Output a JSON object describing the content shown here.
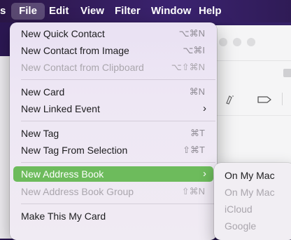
{
  "menubar": {
    "app_fragment": "s",
    "items": [
      "File",
      "Edit",
      "View",
      "Filter",
      "Window",
      "Help"
    ]
  },
  "file_menu": {
    "new_quick_contact": {
      "label": "New Quick Contact",
      "shortcut": "⌥⌘N"
    },
    "new_contact_from_image": {
      "label": "New Contact from Image",
      "shortcut": "⌥⌘I"
    },
    "new_contact_from_clipboard": {
      "label": "New Contact from Clipboard",
      "shortcut": "⌥⇧⌘N"
    },
    "new_card": {
      "label": "New Card",
      "shortcut": "⌘N"
    },
    "new_linked_event": {
      "label": "New Linked Event"
    },
    "new_tag": {
      "label": "New Tag",
      "shortcut": "⌘T"
    },
    "new_tag_from_selection": {
      "label": "New Tag From Selection",
      "shortcut": "⇧⌘T"
    },
    "new_address_book": {
      "label": "New Address Book"
    },
    "new_address_book_group": {
      "label": "New Address Book Group",
      "shortcut": "⇧⌘N"
    },
    "make_this_my_card": {
      "label": "Make This My Card"
    }
  },
  "submenu": {
    "items": [
      "On My Mac",
      "On My Mac",
      "iCloud",
      "Google"
    ]
  },
  "colors": {
    "highlight": "#6dbb5c",
    "menubar": "#3b2370"
  }
}
